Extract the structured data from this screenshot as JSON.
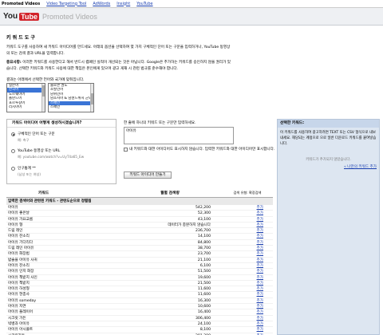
{
  "nav": [
    "Promoted Videos",
    "Video Targeting Tool",
    "AdWords",
    "Insight",
    "YouTube"
  ],
  "brand": {
    "you": "You",
    "tube": "Tube",
    "title": "Promoted Videos"
  },
  "page_title": "키 워 드 도 구",
  "intro": {
    "p1": "키워드 도구를 사용하여 새 키워드 아이디어를 만드세요. 아래의 옵션을 선택하여 몇 가지 구체적인 단어 또는 구문을 입력하거나, YouTube 동영상",
    "p1b": "의 또는 검색 결과 URL을 입력합니다.",
    "p2_bold": "중요사항:",
    "p2": "이러한 키워드를 사용한다고 해서 반드시 캠페인 실적이 개선되는 것은 아닙니다. Google은 추가하는 키워드를 승인하지 않을 권리가 있",
    "p2b": "습니다. 선택한 키워드와 키워드 사용에 대한 책임은 본인에게 있으며 광고 게재 시 관련 법규를 준수해야 합니다."
  },
  "category_label": "결과는 아래에서 선택한 언어와 국가에 맞춰집니다.",
  "list_left": [
    "일본어",
    "한국어",
    "노르웨이어",
    "폴란드어",
    "포르투갈어",
    "러시아어"
  ],
  "list_right": [
    "불로콘 권도",
    "소발인어",
    "남위인어",
    "남조지아 & 남샌드위치 군도",
    "스페인",
    "스페인"
  ],
  "method": {
    "heading": "키워드 아이디어 어떻게 생성하시겠습니까?",
    "opt1": {
      "label": "구체적인 단어 또는 구문",
      "sub": "예: 축구"
    },
    "opt2": {
      "label": "YouTube 동영상 또는 URL",
      "sub": "예: youtube.com/watch?v=UyT4a65_Ew"
    },
    "opt3": {
      "label": "인구통계 **",
      "sub": "(남성 또는 여성)"
    }
  },
  "keyword_prompt": "한 줄에 하나의 키워드 또는 구문만 입력하세요.",
  "keyword_value": "아이유",
  "checkbox_text": "내 키워드와 대한 아이디어도 표시하지 않습니다. 입력한 키워드와 대한 아이디어만 표시합니다.",
  "generate_button": "키워드 아이디어 만들기",
  "side": {
    "heading": "선택한 키워드:",
    "text": "이 키워드를 사용하여 광고하려면 TEXT 또는 CSV 형식으로 내보내세요. 해당되는 계정으로 으로 일반 다운로드 키워드를 붙여넣습니다.",
    "empty": "키워드가 추가되지 않았습니다.",
    "link": "« 나만의 키워드 추가"
  },
  "results": {
    "col_keyword": "키워드",
    "col_volume": "월별 검색량",
    "col_match": "검색 유형: 확장검색",
    "group": "입력한 검색어와 관련된 키워드 - 관련도순으로 정렬됨",
    "add_label": "추가",
    "rows": [
      {
        "kw": "아이유",
        "vol": "542,200"
      },
      {
        "kw": "아이유 좋은날",
        "vol": "52,300"
      },
      {
        "kw": "아이유 가요교름",
        "vol": "43,100"
      },
      {
        "kw": "아이유 형",
        "vol": "데이터가 충분하지 않습니다"
      },
      {
        "kw": "드림 레인",
        "vol": "236,700"
      },
      {
        "kw": "아이유 잔소리",
        "vol": "14,100"
      },
      {
        "kw": "아이유 기다리다",
        "vol": "84,800"
      },
      {
        "kw": "드림 레인 아이유",
        "vol": "38,700"
      },
      {
        "kw": "아이유 화장법",
        "vol": "23,700"
      },
      {
        "kw": "밤술을 아이유 사귀",
        "vol": "21,100"
      },
      {
        "kw": "아이유 잔소리",
        "vol": "6,100"
      },
      {
        "kw": "아이유 인지 화장",
        "vol": "51,500"
      },
      {
        "kw": "아이유 책받지 사인",
        "vol": "19,600"
      },
      {
        "kw": "아이유 책받지",
        "vol": "21,500"
      },
      {
        "kw": "아이유 하성형",
        "vol": "11,600"
      },
      {
        "kw": "아이유 현충사",
        "vol": "11,600"
      },
      {
        "kw": "아이유 someday",
        "vol": "16,300"
      },
      {
        "kw": "아이유 지연",
        "vol": "10,600"
      },
      {
        "kw": "아이유 플레이어",
        "vol": "16,400"
      },
      {
        "kw": "시크릿 가든",
        "vol": "306,400"
      },
      {
        "kw": "빅뱅과 아이유",
        "vol": "24,100"
      },
      {
        "kw": "아이유 아시플트",
        "vol": "8,100"
      },
      {
        "kw": "시크릿가든",
        "vol": "201,200"
      }
    ]
  }
}
